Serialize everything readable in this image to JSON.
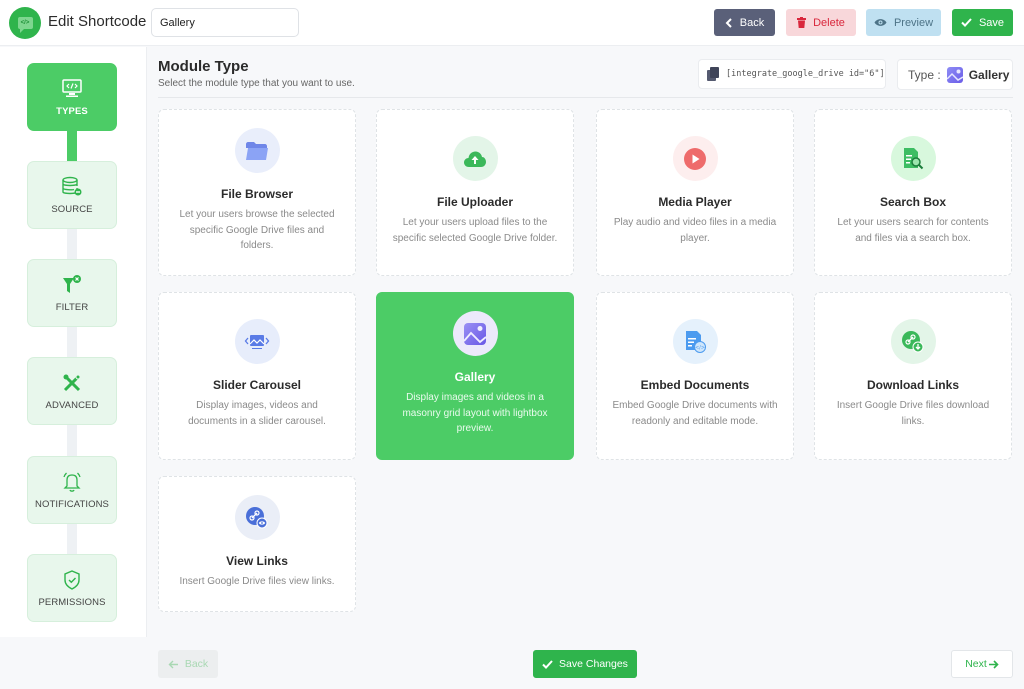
{
  "header": {
    "app_title": "Edit Shortcode",
    "title_input_value": "Gallery",
    "buttons": {
      "back": "Back",
      "delete": "Delete",
      "preview": "Preview",
      "save": "Save"
    },
    "colors": {
      "back": "#5a6079",
      "delete_bg": "#f8d7da",
      "preview_bg": "#bfe0f1",
      "save": "#2fb44c"
    }
  },
  "sidebar": {
    "active_index": 0,
    "steps": [
      {
        "label": "TYPES",
        "icon": "monitor-code-icon"
      },
      {
        "label": "SOURCE",
        "icon": "database-icon"
      },
      {
        "label": "FILTER",
        "icon": "filter-icon"
      },
      {
        "label": "ADVANCED",
        "icon": "tools-icon"
      },
      {
        "label": "NOTIFICATIONS",
        "icon": "bell-icon"
      },
      {
        "label": "PERMISSIONS",
        "icon": "shield-check-icon"
      }
    ]
  },
  "main": {
    "title": "Module Type",
    "subtitle": "Select the module type that you want to use.",
    "shortcode": "[integrate_google_drive id=\"6\"]",
    "type_label": "Type :",
    "type_value": "Gallery",
    "selected_module": "Gallery",
    "modules": [
      {
        "title": "File Browser",
        "desc": "Let your users browse the selected specific Google Drive files and folders.",
        "icon": "folder-icon"
      },
      {
        "title": "File Uploader",
        "desc": "Let your users upload files to the specific selected Google Drive folder.",
        "icon": "cloud-upload-icon"
      },
      {
        "title": "Media Player",
        "desc": "Play audio and video files in a media player.",
        "icon": "play-icon"
      },
      {
        "title": "Search Box",
        "desc": "Let your users search for contents and files via a search box.",
        "icon": "document-search-icon"
      },
      {
        "title": "Slider Carousel",
        "desc": "Display images, videos and documents in a slider carousel.",
        "icon": "slider-icon"
      },
      {
        "title": "Gallery",
        "desc": "Display images and videos in a masonry grid layout with lightbox preview.",
        "icon": "image-icon"
      },
      {
        "title": "Embed Documents",
        "desc": "Embed Google Drive documents with readonly and editable mode.",
        "icon": "embed-document-icon"
      },
      {
        "title": "Download Links",
        "desc": "Insert Google Drive files download links.",
        "icon": "download-link-icon"
      },
      {
        "title": "View Links",
        "desc": "Insert Google Drive files view links.",
        "icon": "view-link-icon"
      }
    ]
  },
  "footer": {
    "back": "Back",
    "save_changes": "Save Changes",
    "next": "Next"
  },
  "accent_color": "#4ccc66"
}
